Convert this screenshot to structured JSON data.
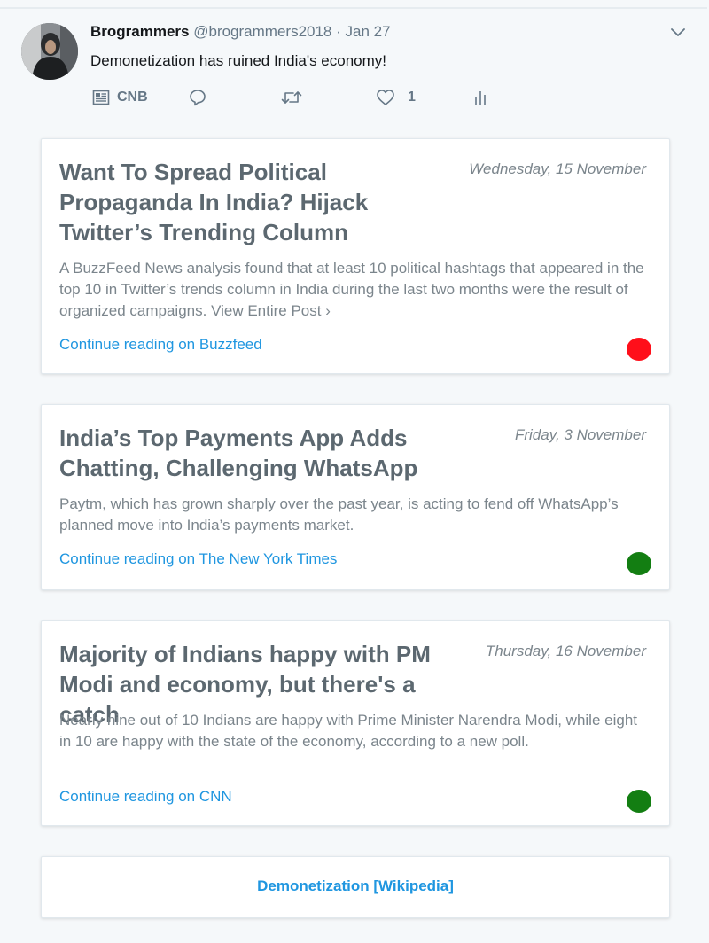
{
  "tweet": {
    "display_name": "Brogrammers",
    "handle": "@brogrammers2018",
    "separator": "·",
    "date": "Jan 27",
    "text": "Demonetization has ruined India's economy!",
    "actions": {
      "news_label": "CNB",
      "like_count": "1"
    }
  },
  "cards": [
    {
      "title": "Want To Spread Political Propaganda In India? Hijack Twitter’s Trending Column",
      "date": "Wednesday, 15 November",
      "summary": "A BuzzFeed News analysis found that at least 10 political hashtags that appeared in the top 10 in Twitter’s trends column in India during the last two months were the result of organized campaigns.",
      "more_label": "View Entire Post ›",
      "link": "Continue reading on Buzzfeed",
      "status_color": "#ff0f1a"
    },
    {
      "title": "India’s Top Payments App Adds Chatting, Challenging WhatsApp",
      "date": "Friday, 3 November",
      "summary": "Paytm, which has grown sharply over the past year, is acting to fend off WhatsApp’s planned move into India’s payments market.",
      "link": "Continue reading on The New York Times",
      "status_color": "#137e12"
    },
    {
      "title": "Majority of Indians happy with PM Modi and economy, but there's a catch",
      "date": "Thursday, 16 November",
      "summary": "Nearly nine out of 10 Indians are happy with Prime Minister Narendra Modi, while eight in 10 are happy with the state of the economy, according to a new poll.",
      "link": "Continue reading on CNN",
      "status_color": "#137e12"
    }
  ],
  "wiki_link": "Demonetization [Wikipedia]",
  "icons": {
    "news": "newspaper-icon",
    "reply": "reply-icon",
    "retweet": "retweet-icon",
    "like": "heart-icon",
    "analytics": "analytics-icon",
    "menu": "chevron-down-icon"
  },
  "colors": {
    "link": "#1f96e0",
    "muted": "#657786"
  }
}
